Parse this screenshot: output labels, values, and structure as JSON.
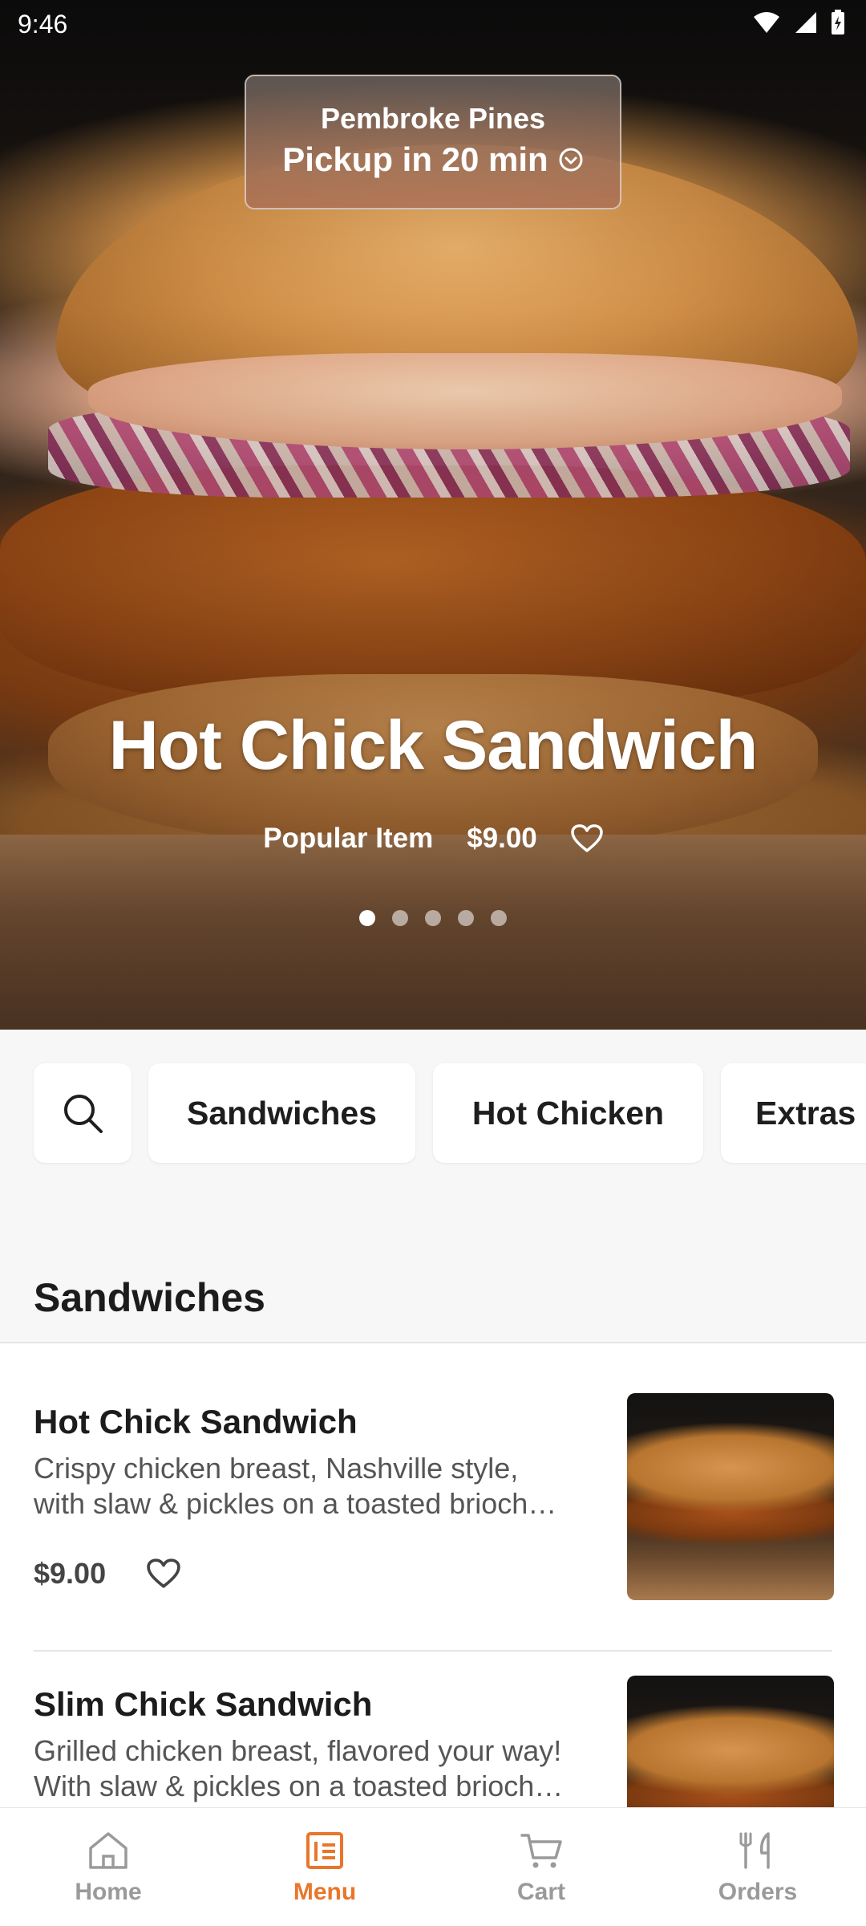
{
  "status_bar": {
    "time": "9:46"
  },
  "location": {
    "city": "Pembroke Pines",
    "pickup": "Pickup in 20 min"
  },
  "hero": {
    "title": "Hot Chick Sandwich",
    "badge": "Popular Item",
    "price": "$9.00",
    "carousel": {
      "total": 5,
      "active_index": 0
    }
  },
  "filters": {
    "search_icon": "search-icon",
    "chips": [
      "Sandwiches",
      "Hot Chicken",
      "Extras"
    ]
  },
  "section": {
    "title": "Sandwiches"
  },
  "items": [
    {
      "name": "Hot Chick Sandwich",
      "desc_line1": "Crispy chicken breast, Nashville style,",
      "desc_line2": "with slaw & pickles on a toasted brioch…",
      "price": "$9.00"
    },
    {
      "name": "Slim Chick Sandwich",
      "desc_line1": "Grilled chicken breast, flavored your way!",
      "desc_line2": "With slaw & pickles on a toasted brioch…"
    }
  ],
  "bottom_nav": {
    "items": [
      {
        "label": "Home",
        "icon": "home-icon"
      },
      {
        "label": "Menu",
        "icon": "menu-icon"
      },
      {
        "label": "Cart",
        "icon": "cart-icon"
      },
      {
        "label": "Orders",
        "icon": "orders-icon"
      }
    ],
    "active": "Menu"
  },
  "colors": {
    "accent": "#e8762b",
    "inactive": "#9a9a9a"
  }
}
